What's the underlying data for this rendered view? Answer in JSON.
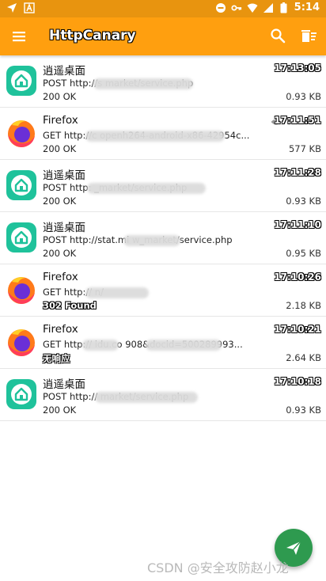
{
  "status_bar": {
    "time": "5:14"
  },
  "app_bar": {
    "title": "HttpCanary"
  },
  "requests": [
    {
      "app": "逍遥桌面",
      "icon": "launcher-icon",
      "method_url": "POST http://s                              market/service.php",
      "status": "200 OK",
      "time": "17:13:05",
      "size": "0.93 KB"
    },
    {
      "app": "Firefox",
      "icon": "firefox-icon",
      "method_url": "GET http://c                                         openh264-android-x86-42954c...",
      "status": "200 OK",
      "time": "17:11:51",
      "size": "577 KB",
      "viewed": true
    },
    {
      "app": "逍遥桌面",
      "icon": "launcher-icon",
      "method_url": "POST http:                                  _market/service.php",
      "status": "200 OK",
      "time": "17:11:28",
      "size": "0.93 KB"
    },
    {
      "app": "逍遥桌面",
      "icon": "launcher-icon",
      "method_url": "POST http://stat.mi                    w_market/service.php",
      "status": "200 OK",
      "time": "17:11:10",
      "size": "0.95 KB"
    },
    {
      "app": "Firefox",
      "icon": "firefox-icon",
      "method_url": "GET http://                          n/",
      "status": "302 Found",
      "status_outlined": true,
      "time": "17:10:26",
      "size": "2.18 KB"
    },
    {
      "app": "Firefox",
      "icon": "firefox-icon",
      "method_url": "GET http://              idu.co                              908&docid=500289993...",
      "status": "无响应",
      "status_outlined": true,
      "time": "17:10:21",
      "size": "2.64 KB"
    },
    {
      "app": "逍遥桌面",
      "icon": "launcher-icon",
      "method_url": "POST http://                                   market/service.php",
      "status": "200 OK",
      "time": "17:10:18",
      "size": "0.93 KB"
    }
  ],
  "watermark": "CSDN @安全攻防赵小龙",
  "colors": {
    "status_bar": "#e8940f",
    "app_bar": "#ff9f0f",
    "fab": "#2e9a4f",
    "launcher_teal": "#1fc29b",
    "firefox_orange": "#ff7a1a",
    "firefox_purple": "#6a2fd6"
  }
}
